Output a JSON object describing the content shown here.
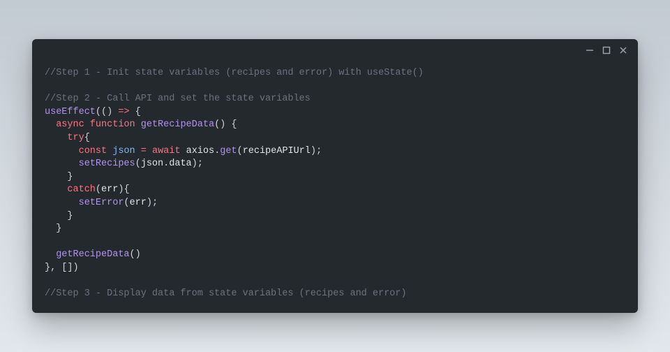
{
  "window": {
    "minimize_tip": "Minimize",
    "maximize_tip": "Maximize",
    "close_tip": "Close"
  },
  "code": {
    "lines": [
      {
        "kind": "comment",
        "text": "//Step 1 - Init state variables (recipes and error) with useState()"
      },
      {
        "kind": "blank"
      },
      {
        "kind": "comment",
        "text": "//Step 2 - Call API and set the state variables"
      },
      {
        "kind": "raw",
        "segments": [
          {
            "cls": "c-call",
            "text": "useEffect"
          },
          {
            "cls": "c-punct",
            "text": "(() "
          },
          {
            "cls": "c-keyword",
            "text": "=>"
          },
          {
            "cls": "c-punct",
            "text": " {"
          }
        ]
      },
      {
        "kind": "raw",
        "indent": 1,
        "segments": [
          {
            "cls": "c-keyword",
            "text": "async"
          },
          {
            "cls": "c-punct",
            "text": " "
          },
          {
            "cls": "c-keyword",
            "text": "function"
          },
          {
            "cls": "c-punct",
            "text": " "
          },
          {
            "cls": "c-funcdef",
            "text": "getRecipeData"
          },
          {
            "cls": "c-punct",
            "text": "() {"
          }
        ]
      },
      {
        "kind": "raw",
        "indent": 2,
        "segments": [
          {
            "cls": "c-keyword",
            "text": "try"
          },
          {
            "cls": "c-punct",
            "text": "{"
          }
        ]
      },
      {
        "kind": "raw",
        "indent": 3,
        "segments": [
          {
            "cls": "c-keyword",
            "text": "const"
          },
          {
            "cls": "c-punct",
            "text": " "
          },
          {
            "cls": "c-property",
            "text": "json"
          },
          {
            "cls": "c-punct",
            "text": " "
          },
          {
            "cls": "c-keyword",
            "text": "="
          },
          {
            "cls": "c-punct",
            "text": " "
          },
          {
            "cls": "c-keyword",
            "text": "await"
          },
          {
            "cls": "c-punct",
            "text": " "
          },
          {
            "cls": "c-variable",
            "text": "axios"
          },
          {
            "cls": "c-punct",
            "text": "."
          },
          {
            "cls": "c-call",
            "text": "get"
          },
          {
            "cls": "c-punct",
            "text": "("
          },
          {
            "cls": "c-variable",
            "text": "recipeAPIUrl"
          },
          {
            "cls": "c-punct",
            "text": ");"
          }
        ]
      },
      {
        "kind": "raw",
        "indent": 3,
        "segments": [
          {
            "cls": "c-call",
            "text": "setRecipes"
          },
          {
            "cls": "c-punct",
            "text": "("
          },
          {
            "cls": "c-variable",
            "text": "json"
          },
          {
            "cls": "c-punct",
            "text": "."
          },
          {
            "cls": "c-variable",
            "text": "data"
          },
          {
            "cls": "c-punct",
            "text": ");"
          }
        ]
      },
      {
        "kind": "raw",
        "indent": 2,
        "segments": [
          {
            "cls": "c-punct",
            "text": "}"
          }
        ]
      },
      {
        "kind": "raw",
        "indent": 2,
        "segments": [
          {
            "cls": "c-keyword",
            "text": "catch"
          },
          {
            "cls": "c-punct",
            "text": "("
          },
          {
            "cls": "c-variable",
            "text": "err"
          },
          {
            "cls": "c-punct",
            "text": "){"
          }
        ]
      },
      {
        "kind": "raw",
        "indent": 3,
        "segments": [
          {
            "cls": "c-call",
            "text": "setError"
          },
          {
            "cls": "c-punct",
            "text": "("
          },
          {
            "cls": "c-variable",
            "text": "err"
          },
          {
            "cls": "c-punct",
            "text": ");"
          }
        ]
      },
      {
        "kind": "raw",
        "indent": 2,
        "segments": [
          {
            "cls": "c-punct",
            "text": "}"
          }
        ]
      },
      {
        "kind": "raw",
        "indent": 1,
        "segments": [
          {
            "cls": "c-punct",
            "text": "}"
          }
        ]
      },
      {
        "kind": "blank"
      },
      {
        "kind": "raw",
        "indent": 1,
        "segments": [
          {
            "cls": "c-call",
            "text": "getRecipeData"
          },
          {
            "cls": "c-punct",
            "text": "()"
          }
        ]
      },
      {
        "kind": "raw",
        "segments": [
          {
            "cls": "c-punct",
            "text": "}, [])"
          }
        ]
      },
      {
        "kind": "blank"
      },
      {
        "kind": "comment",
        "text": "//Step 3 - Display data from state variables (recipes and error)"
      }
    ]
  }
}
